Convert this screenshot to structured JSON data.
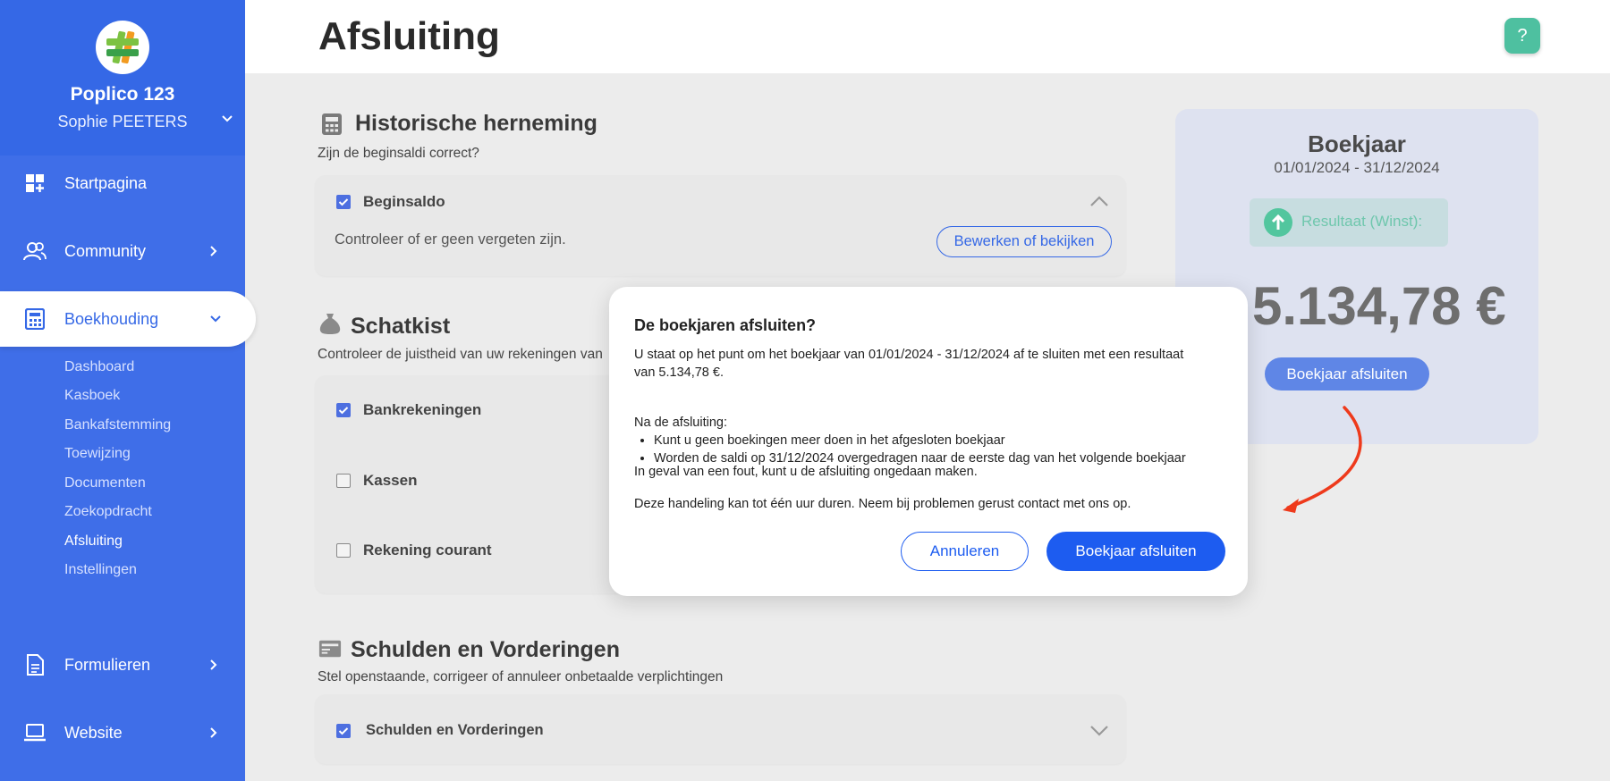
{
  "sidebar": {
    "org_name": "Poplico 123",
    "user_name": "Sophie PEETERS",
    "nav": {
      "startpagina": "Startpagina",
      "community": "Community",
      "boekhouding": "Boekhouding",
      "formulieren": "Formulieren",
      "website": "Website"
    },
    "sub_items": [
      "Dashboard",
      "Kasboek",
      "Bankafstemming",
      "Toewijzing",
      "Documenten",
      "Zoekopdracht",
      "Afsluiting",
      "Instellingen"
    ],
    "active_sub": "Afsluiting"
  },
  "header": {
    "title": "Afsluiting",
    "help_label": "?"
  },
  "historische": {
    "title": "Historische herneming",
    "subtitle": "Zijn de beginsaldi correct?",
    "item_label": "Beginsaldo",
    "item_checked": true,
    "description": "Controleer of er geen vergeten zijn.",
    "button": "Bewerken of bekijken"
  },
  "schatkist": {
    "title": "Schatkist",
    "subtitle": "Controleer de juistheid van uw rekeningen van",
    "items": [
      {
        "label": "Bankrekeningen",
        "checked": true
      },
      {
        "label": "Kassen",
        "checked": false
      },
      {
        "label": "Rekening courant",
        "checked": false
      }
    ]
  },
  "schulden": {
    "title": "Schulden en Vorderingen",
    "subtitle": "Stel openstaande, corrigeer of annuleer onbetaalde verplichtingen",
    "item_label": "Schulden en Vorderingen",
    "item_checked": true
  },
  "boekjaar": {
    "title": "Boekjaar",
    "range": "01/01/2024 - 31/12/2024",
    "result_label": "Resultaat (Winst):",
    "amount": "5.134,78 €",
    "button": "Boekjaar afsluiten"
  },
  "modal": {
    "title": "De boekjaren afsluiten?",
    "intro": "U staat op het punt om het boekjaar van 01/01/2024 - 31/12/2024 af te sluiten met een resultaat van 5.134,78 €.",
    "after_heading": "Na de afsluiting:",
    "after_items": [
      "Kunt u geen boekingen meer doen in het afgesloten boekjaar",
      "Worden de saldi op 31/12/2024 overgedragen naar de eerste dag van het volgende boekjaar"
    ],
    "undo_note": "In geval van een fout, kunt u de afsluiting ongedaan maken.",
    "duration_note": "Deze handeling kan tot één uur duren. Neem bij problemen gerust contact met ons op.",
    "cancel_button": "Annuleren",
    "confirm_button": "Boekjaar afsluiten"
  },
  "colors": {
    "sidebar": "#3f6ee8",
    "primary": "#1d5cf0",
    "success": "#52c69e"
  }
}
